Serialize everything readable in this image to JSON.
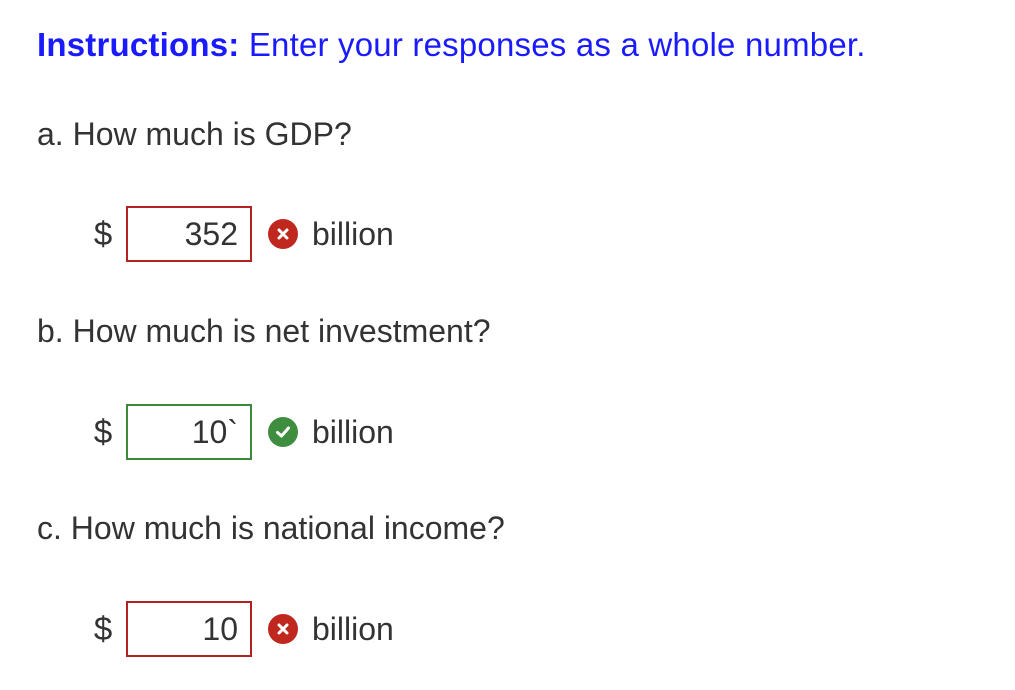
{
  "instructions": {
    "label": "Instructions:",
    "text": "Enter your responses as a whole number."
  },
  "questions": [
    {
      "prompt": "a. How much is GDP?",
      "currency": "$",
      "value": "352",
      "status": "incorrect",
      "status_icon": "x-circle-icon",
      "unit": "billion"
    },
    {
      "prompt": "b. How much is net investment?",
      "currency": "$",
      "value": "10`",
      "status": "correct",
      "status_icon": "check-circle-icon",
      "unit": "billion"
    },
    {
      "prompt": "c. How much is national income?",
      "currency": "$",
      "value": "10",
      "status": "incorrect",
      "status_icon": "x-circle-icon",
      "unit": "billion"
    }
  ],
  "colors": {
    "instructions": "#1a1aff",
    "incorrect": "#c0271f",
    "correct": "#3f8d3f",
    "text": "#333333"
  }
}
